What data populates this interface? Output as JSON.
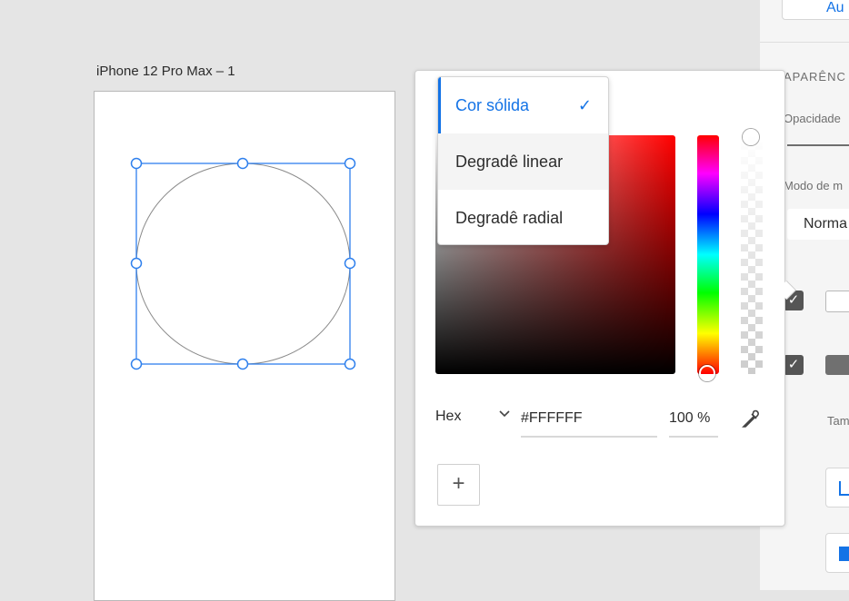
{
  "artboard": {
    "title": "iPhone 12 Pro Max – 1"
  },
  "right_panel": {
    "top_button_label": "Au",
    "section_title": "APARÊNC",
    "opacity_label": "Opacidade",
    "blend_mode_label": "Modo de m",
    "blend_mode_value": "Norma",
    "fill_check": "✓",
    "border_check": "✓",
    "size_label": "Tam"
  },
  "color_picker": {
    "color_mode": "Hex",
    "mode_chevron": "⌄",
    "hex_value": "#FFFFFF",
    "opacity_value": "100 %",
    "add_swatch_label": "+",
    "accent_color": "#1473e6",
    "hue_color": "#ff0000"
  },
  "fill_type_menu": {
    "items": [
      {
        "label": "Cor sólida",
        "selected": true
      },
      {
        "label": "Degradê linear",
        "selected": false
      },
      {
        "label": "Degradê radial",
        "selected": false
      }
    ],
    "check_glyph": "✓"
  }
}
